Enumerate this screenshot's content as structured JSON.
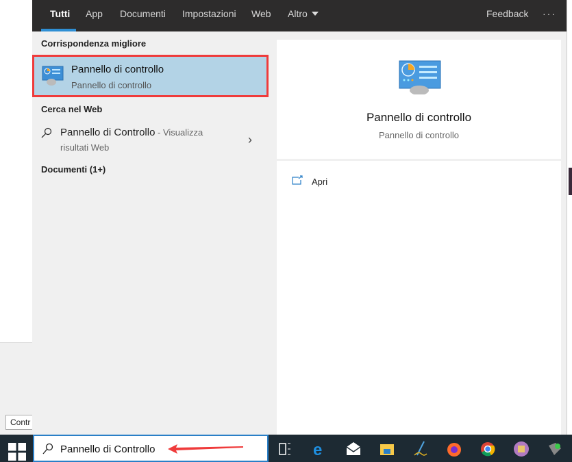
{
  "background": {
    "input_text": "Contr"
  },
  "header": {
    "tabs": [
      {
        "label": "Tutti",
        "active": true
      },
      {
        "label": "App"
      },
      {
        "label": "Documenti"
      },
      {
        "label": "Impostazioni"
      },
      {
        "label": "Web"
      },
      {
        "label": "Altro"
      }
    ],
    "feedback": "Feedback",
    "more": "···"
  },
  "results": {
    "best_match_heading": "Corrispondenza migliore",
    "best_match": {
      "title": "Pannello di controllo",
      "subtitle": "Pannello di controllo",
      "icon": "control-panel-icon"
    },
    "web_heading": "Cerca nel Web",
    "web_item": {
      "title": "Pannello di Controllo",
      "suffix": " - Visualizza",
      "line2": "risultati Web"
    },
    "docs_heading": "Documenti (1+)"
  },
  "preview": {
    "title": "Pannello di controllo",
    "subtitle": "Pannello di controllo",
    "actions": [
      {
        "label": "Apri",
        "icon": "open-icon"
      }
    ]
  },
  "taskbar": {
    "search_value": "Pannello di Controllo",
    "icons": [
      "windows-start",
      "task-view",
      "edge",
      "mail",
      "file-explorer",
      "pen-app",
      "firefox",
      "chrome",
      "app-purple",
      "app-green"
    ]
  },
  "colors": {
    "accent": "#2f8fd4",
    "highlight": "#b3d3e6",
    "annotation": "#ef3b3b"
  }
}
